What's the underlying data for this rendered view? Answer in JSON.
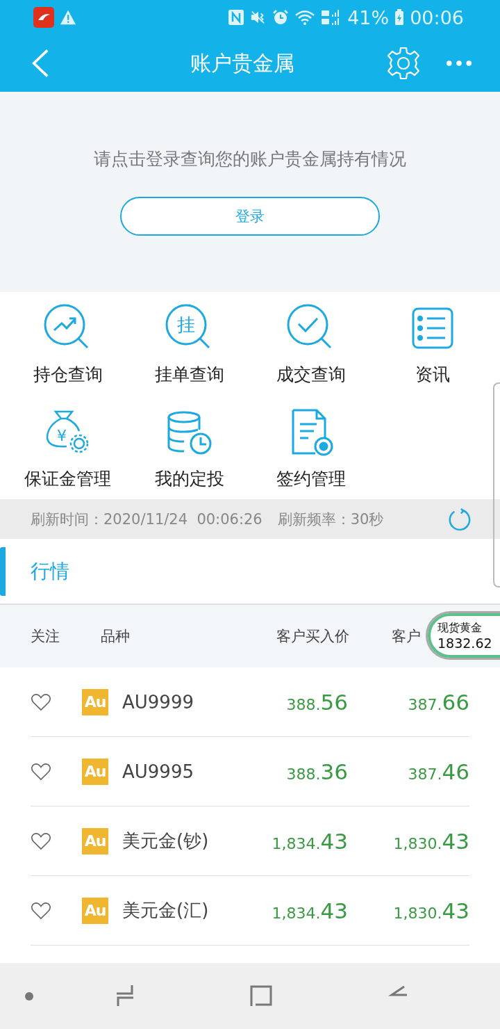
{
  "status_bar": {
    "battery": "41%",
    "time": "00:06"
  },
  "app_bar": {
    "title": "账户贵金属"
  },
  "login_panel": {
    "prompt": "请点击登录查询您的账户贵金属持有情况",
    "button": "登录"
  },
  "shortcuts": [
    {
      "label": "持仓查询",
      "kind": "trend"
    },
    {
      "label": "挂单查询",
      "kind": "pending",
      "glyph": "挂"
    },
    {
      "label": "成交查询",
      "kind": "deal"
    },
    {
      "label": "资讯",
      "kind": "news"
    },
    {
      "label": "保证金管理",
      "kind": "margin",
      "glyph": "¥"
    },
    {
      "label": "我的定投",
      "kind": "invest"
    },
    {
      "label": "签约管理",
      "kind": "sign"
    }
  ],
  "refresh_bar": {
    "time": "刷新时间：2020/11/24  00:06:26",
    "frequency": "刷新频率：30秒"
  },
  "tabs": [
    {
      "label": "行情",
      "selected": true
    }
  ],
  "table": {
    "columns": [
      "关注",
      "品种",
      "客户买入价",
      "客户"
    ],
    "rows": [
      {
        "favorite": false,
        "badge": "Au",
        "name": "AU9999",
        "buy_main": "388.",
        "buy_tail": "56",
        "sell_main": "387.",
        "sell_tail": "66"
      },
      {
        "favorite": false,
        "badge": "Au",
        "name": "AU9995",
        "buy_main": "388.",
        "buy_tail": "36",
        "sell_main": "387.",
        "sell_tail": "46"
      },
      {
        "favorite": false,
        "badge": "Au",
        "name": "美元金(钞)",
        "buy_main": "1,834.",
        "buy_tail": "43",
        "sell_main": "1,830.",
        "sell_tail": "43"
      },
      {
        "favorite": false,
        "badge": "Au",
        "name": "美元金(汇)",
        "buy_main": "1,834.",
        "buy_tail": "43",
        "sell_main": "1,830.",
        "sell_tail": "43"
      }
    ]
  },
  "floating_quote": {
    "label": "现货黄金",
    "price": "1832.62"
  }
}
